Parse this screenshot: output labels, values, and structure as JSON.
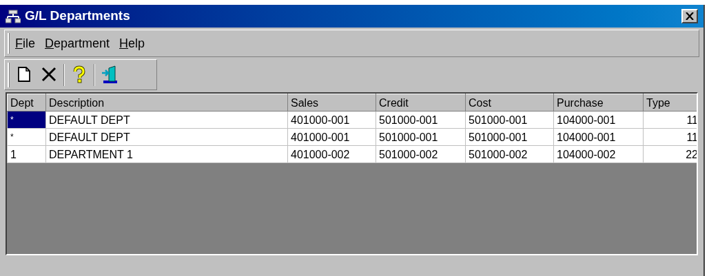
{
  "window": {
    "title": "G/L Departments"
  },
  "menu": [
    {
      "label": "File"
    },
    {
      "label": "Department"
    },
    {
      "label": "Help"
    }
  ],
  "toolbar": [
    {
      "kind": "new"
    },
    {
      "kind": "delete"
    },
    {
      "kind": "separator"
    },
    {
      "kind": "help"
    },
    {
      "kind": "separator"
    },
    {
      "kind": "exit"
    }
  ],
  "table": {
    "columns": [
      {
        "label": "Dept",
        "kind": "text"
      },
      {
        "label": "Description",
        "kind": "text"
      },
      {
        "label": "Sales",
        "kind": "text"
      },
      {
        "label": "Credit",
        "kind": "text"
      },
      {
        "label": "Cost",
        "kind": "text"
      },
      {
        "label": "Purchase",
        "kind": "text"
      },
      {
        "label": "Type",
        "kind": "number"
      }
    ],
    "rows": [
      {
        "selected": true,
        "cells": [
          "*",
          "DEFAULT DEPT",
          "401000-001",
          "501000-001",
          "501000-001",
          "104000-001",
          "11"
        ]
      },
      {
        "selected": false,
        "cells": [
          "*",
          "DEFAULT DEPT",
          "401000-001",
          "501000-001",
          "501000-001",
          "104000-001",
          "11"
        ]
      },
      {
        "selected": false,
        "cells": [
          "1",
          "DEPARTMENT 1",
          "401000-002",
          "501000-002",
          "501000-002",
          "104000-002",
          "22"
        ]
      }
    ]
  }
}
